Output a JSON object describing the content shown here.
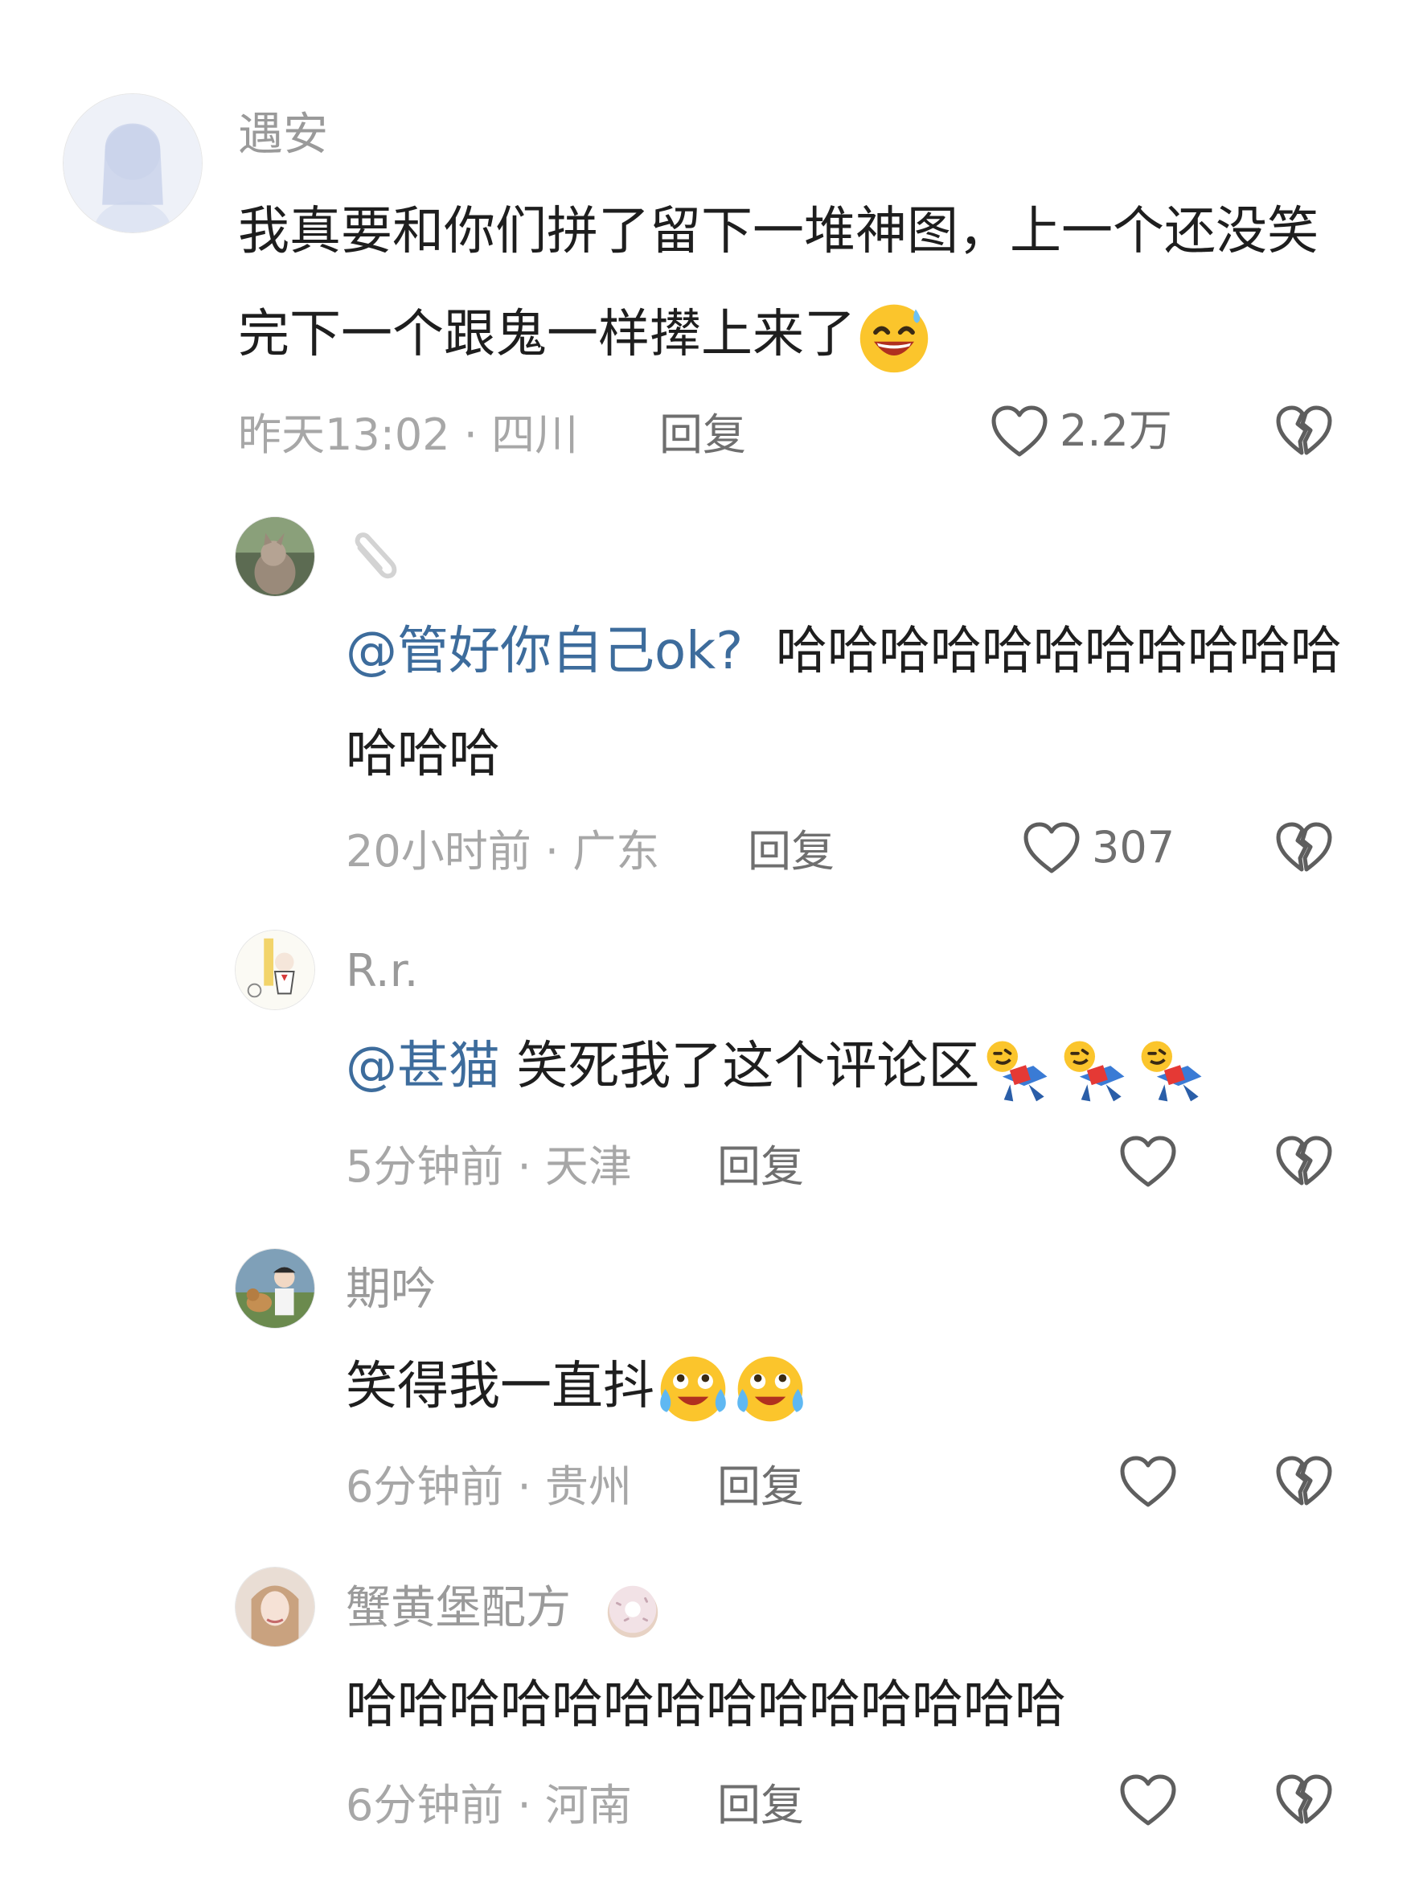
{
  "comments": [
    {
      "username": "遇安",
      "text": "我真要和你们拼了留下一堆神图，上一个还没笑完下一个跟鬼一样撵上来了",
      "meta": "昨天13:02 · 四川",
      "reply_label": "回复",
      "likes": "2.2万",
      "emoji": "grinning-sweat-emoji"
    },
    {
      "username": "",
      "badge": "paperclip-icon",
      "mention": "@管好你自己ok?",
      "text": "哈哈哈哈哈哈哈哈哈哈哈哈哈哈",
      "meta": "20小时前 · 广东",
      "reply_label": "回复",
      "likes": "307"
    },
    {
      "username": "R.r.",
      "mention": "@甚猫",
      "text": "笑死我了这个评论区",
      "meta": "5分钟前 · 天津",
      "reply_label": "回复",
      "likes": "",
      "emoji": "rolling-laughing-emoji"
    },
    {
      "username": "期吟",
      "text": "笑得我一直抖",
      "meta": "6分钟前 · 贵州",
      "reply_label": "回复",
      "likes": "",
      "emoji": "crying-laughing-emoji"
    },
    {
      "username": "蟹黄堡配方",
      "badge": "donut-icon",
      "text": "哈哈哈哈哈哈哈哈哈哈哈哈哈哈",
      "meta": "6分钟前 · 河南",
      "reply_label": "回复",
      "likes": ""
    }
  ]
}
